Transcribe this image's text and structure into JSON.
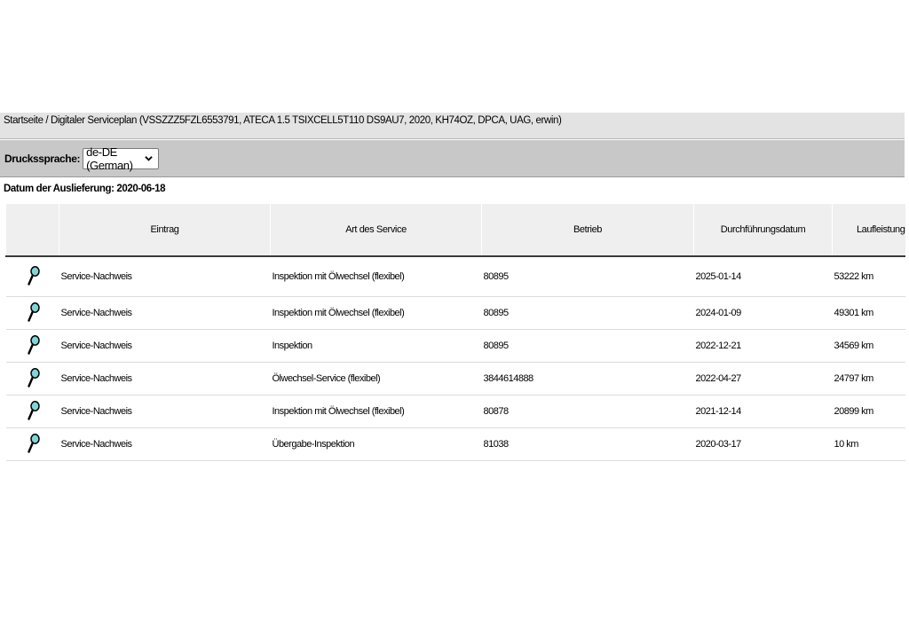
{
  "breadcrumb": {
    "text": "Startseite / Digitaler Serviceplan (VSSZZZ5FZL6553791, ATECA 1.5 TSIXCELL5T110 DS9AU7, 2020, KH74OZ, DPCA, UAG, erwin)"
  },
  "print_language": {
    "label": "Druckssprache:",
    "selected": "de-DE (German)"
  },
  "delivery_date": "Datum der Auslieferung: 2020-06-18",
  "table": {
    "headers": [
      "",
      "Eintrag",
      "Art des Service",
      "Betrieb",
      "Durchführungsdatum",
      "Laufleistung"
    ],
    "rows": [
      {
        "eintrag": "Service-Nachweis",
        "art": "Inspektion mit Ölwechsel (flexibel)",
        "betrieb": "80895",
        "datum": "2025-01-14",
        "laufleistung": "53222 km"
      },
      {
        "eintrag": "Service-Nachweis",
        "art": "Inspektion mit Ölwechsel (flexibel)",
        "betrieb": "80895",
        "datum": "2024-01-09",
        "laufleistung": "49301 km"
      },
      {
        "eintrag": "Service-Nachweis",
        "art": "Inspektion",
        "betrieb": "80895",
        "datum": "2022-12-21",
        "laufleistung": "34569 km"
      },
      {
        "eintrag": "Service-Nachweis",
        "art": "Ölwechsel-Service (flexibel)",
        "betrieb": "3844614888",
        "datum": "2022-04-27",
        "laufleistung": "24797 km"
      },
      {
        "eintrag": "Service-Nachweis",
        "art": "Inspektion mit Ölwechsel (flexibel)",
        "betrieb": "80878",
        "datum": "2021-12-14",
        "laufleistung": "20899 km"
      },
      {
        "eintrag": "Service-Nachweis",
        "art": "Übergabe-Inspektion",
        "betrieb": "81038",
        "datum": "2020-03-17",
        "laufleistung": "10 km"
      }
    ]
  },
  "icons": {
    "detail": "magnifier-icon",
    "dropdown": "chevron-down-icon"
  },
  "colors": {
    "breadcrumb_bg": "#e3e3e3",
    "toolbar_bg": "#c8c8c8",
    "header_bg": "#efefef",
    "magnifier_lens": "#7fd6d6"
  }
}
